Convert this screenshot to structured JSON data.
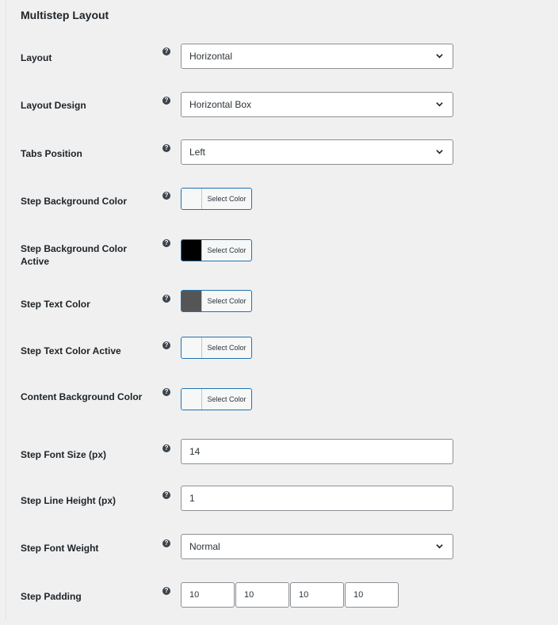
{
  "section_title": "Multistep Layout",
  "help_glyph": "?",
  "fields": {
    "layout": {
      "label": "Layout",
      "value": "Horizontal"
    },
    "layout_design": {
      "label": "Layout Design",
      "value": "Horizontal Box"
    },
    "tabs_position": {
      "label": "Tabs Position",
      "value": "Left"
    },
    "step_bg_color": {
      "label": "Step Background Color",
      "button": "Select Color",
      "color": "#f6f7f7"
    },
    "step_bg_color_active": {
      "label": "Step Background Color Active",
      "button": "Select Color",
      "color": "#000000"
    },
    "step_text_color": {
      "label": "Step Text Color",
      "button": "Select Color",
      "color": "#555555"
    },
    "step_text_color_active": {
      "label": "Step Text Color Active",
      "button": "Select Color",
      "color": "#f6f7f7"
    },
    "content_bg_color": {
      "label": "Content Background Color",
      "button": "Select Color",
      "color": "#f6f7f7"
    },
    "step_font_size": {
      "label": "Step Font Size (px)",
      "value": "14"
    },
    "step_line_height": {
      "label": "Step Line Height (px)",
      "value": "1"
    },
    "step_font_weight": {
      "label": "Step Font Weight",
      "value": "Normal"
    },
    "step_padding": {
      "label": "Step Padding",
      "values": [
        "10",
        "10",
        "10",
        "10"
      ]
    }
  }
}
